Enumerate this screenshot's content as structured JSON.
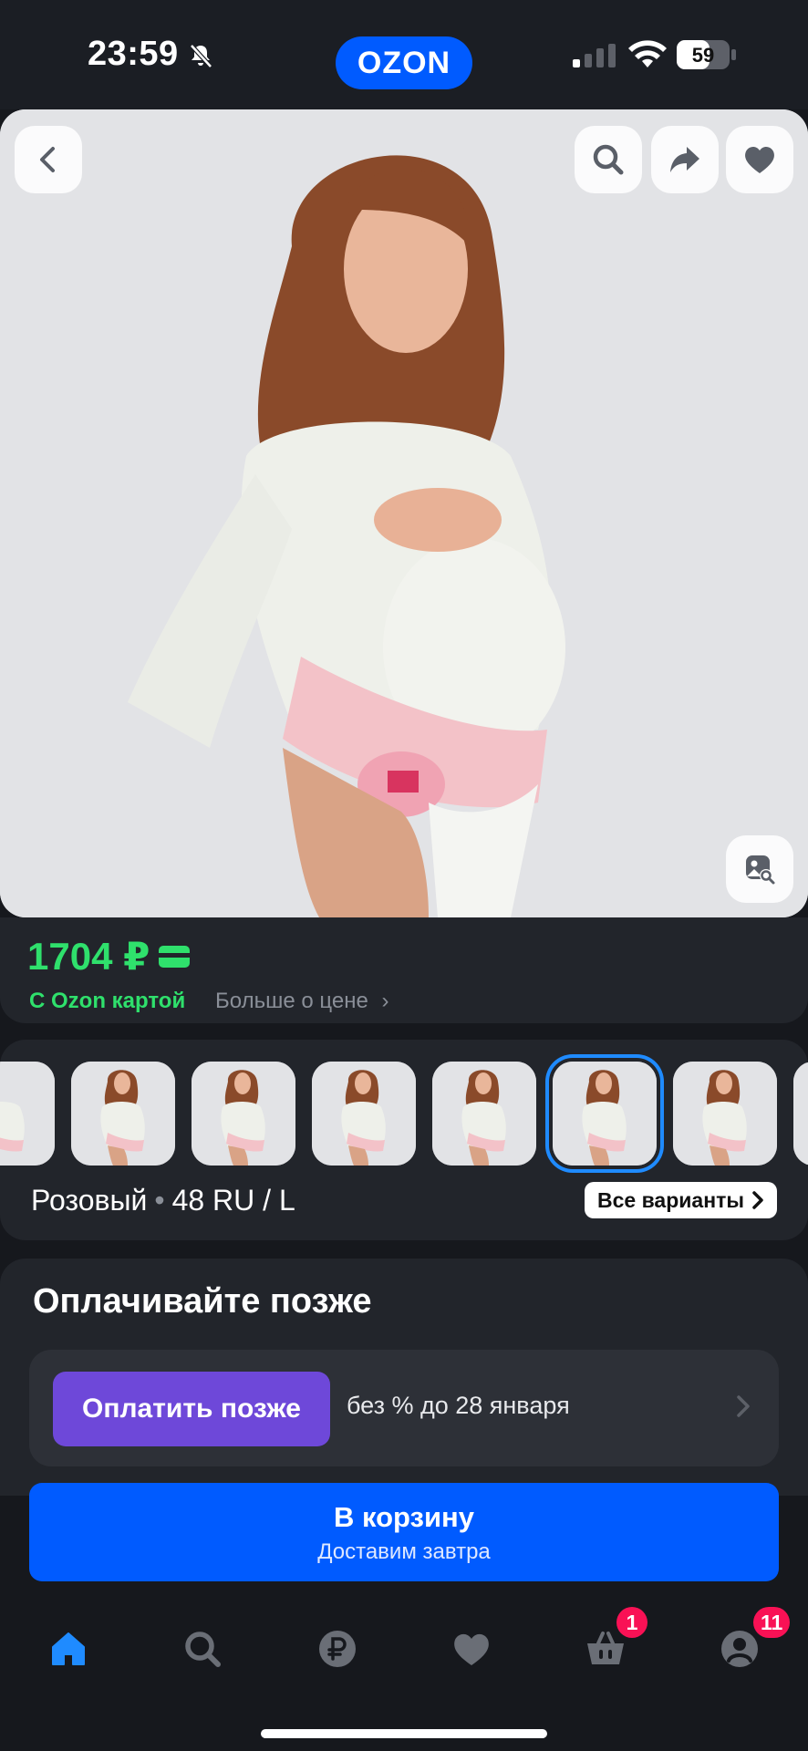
{
  "status_bar": {
    "time": "23:59",
    "battery": "59",
    "app_logo": "OZON"
  },
  "product": {
    "price": "1704 ₽",
    "price_note": "С Ozon картой",
    "price_more": "Больше о цене",
    "variant_color": "Розовый",
    "variant_separator": "•",
    "variant_size": "48 RU / L",
    "all_variants_label": "Все варианты",
    "thumbnail_count": 7,
    "selected_thumbnail_index": 4
  },
  "pay_later": {
    "title": "Оплачивайте позже",
    "button_label": "Оплатить позже",
    "terms": "без % до 28 января"
  },
  "cart": {
    "label": "В корзину",
    "sublabel": "Доставим завтра"
  },
  "bottom_nav": {
    "items": [
      "home-icon",
      "search-icon",
      "ruble-icon",
      "heart-icon",
      "basket-icon",
      "profile-icon"
    ],
    "basket_badge": "1",
    "profile_badge": "11"
  },
  "colors": {
    "accent": "#005bff",
    "price_green": "#2fe06c",
    "pay_later_purple": "#6e48d9",
    "badge_pink": "#f91155"
  }
}
